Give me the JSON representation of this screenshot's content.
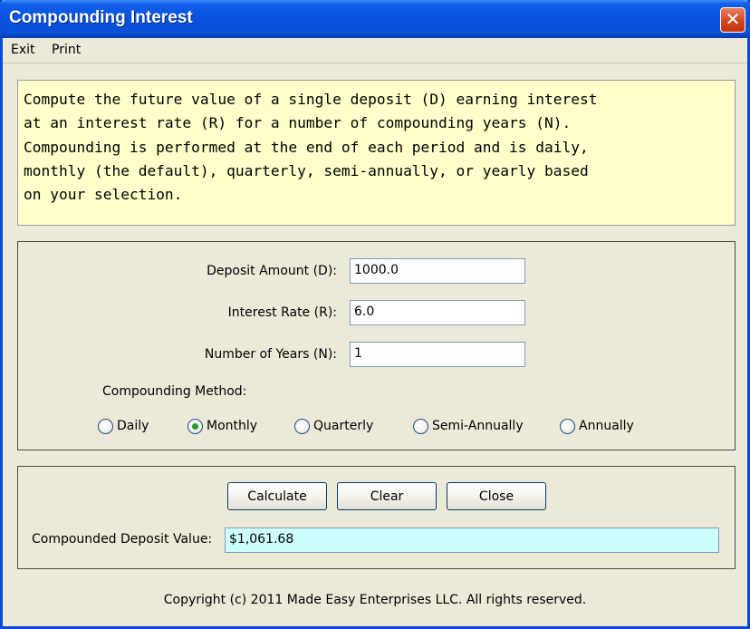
{
  "window": {
    "title": "Compounding Interest",
    "close_glyph": "✕"
  },
  "menu": {
    "exit": "Exit",
    "print": "Print"
  },
  "description": "Compute the future value of a single deposit (D) earning interest\nat an interest rate (R) for a number of compounding years (N).\nCompounding is performed at the end of each period and is daily,\nmonthly (the default), quarterly, semi-annually, or yearly based\non your selection.",
  "inputs": {
    "deposit_label": "Deposit Amount (D):",
    "deposit_value": "1000.0",
    "rate_label": "Interest Rate (R):",
    "rate_value": "6.0",
    "years_label": "Number of Years (N):",
    "years_value": "1"
  },
  "compounding": {
    "label": "Compounding Method:",
    "options": [
      "Daily",
      "Monthly",
      "Quarterly",
      "Semi-Annually",
      "Annually"
    ],
    "selected": "Monthly"
  },
  "buttons": {
    "calculate": "Calculate",
    "clear": "Clear",
    "close": "Close"
  },
  "result": {
    "label": "Compounded Deposit Value:",
    "value": "$1,061.68"
  },
  "footer": {
    "copyright": "Copyright (c) 2011 Made Easy Enterprises LLC. All rights reserved."
  },
  "colors": {
    "titlebar": "#0a53e0",
    "description_bg": "#ffffcc",
    "result_bg": "#cdfdfd",
    "radio_selected": "#21a121"
  }
}
